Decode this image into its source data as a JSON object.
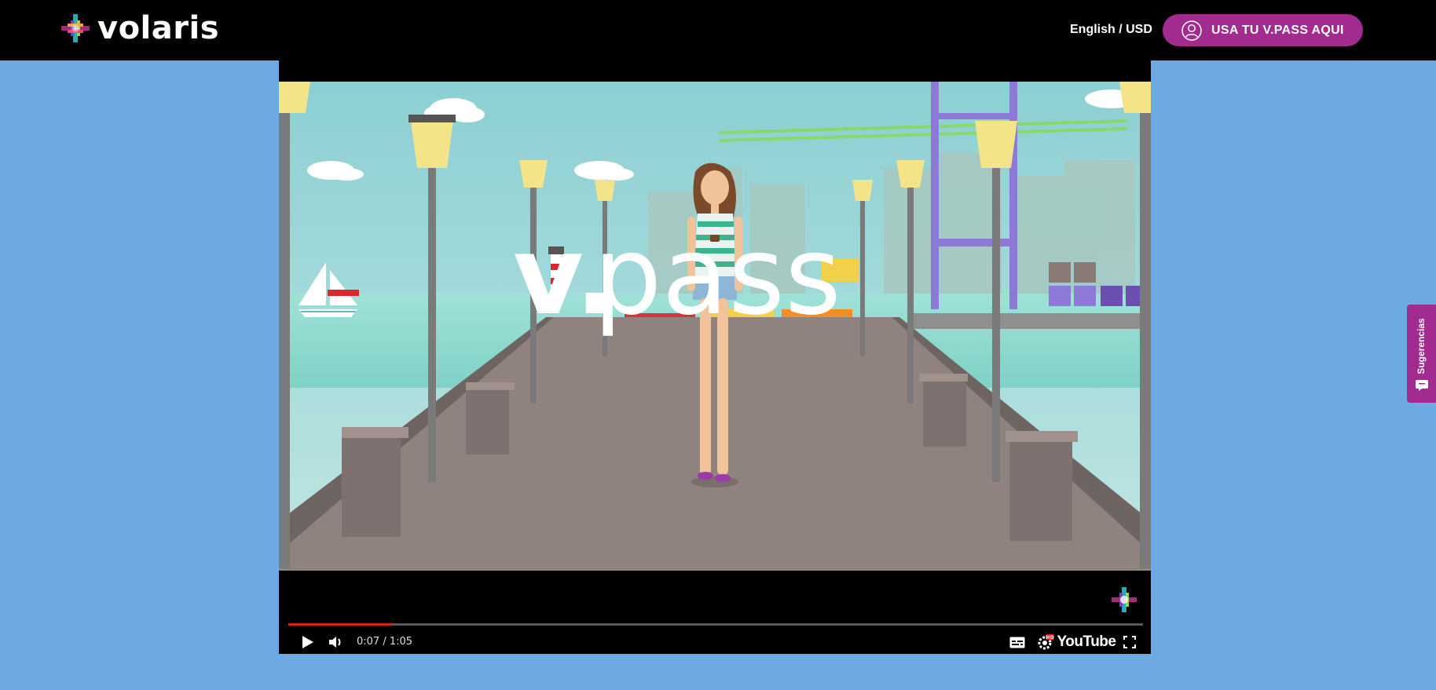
{
  "header": {
    "brand": "volaris",
    "language_currency": "English / USD",
    "vpass_button": "USA TU V.PASS AQUI"
  },
  "video": {
    "title_overlay": "v.pass",
    "time_display": "0:07 / 1:05",
    "progress_fraction": 0.12,
    "quality_badge": "HD",
    "brand_button": "YouTube"
  },
  "feedback_tab": {
    "label": "Sugerencias"
  },
  "colors": {
    "page_background": "#6daae3",
    "brand_purple": "#a12b8e",
    "progress_red": "#e01e1e"
  },
  "icons": [
    "user-icon",
    "play-icon",
    "volume-icon",
    "subtitles-icon",
    "settings-icon",
    "fullscreen-icon",
    "feedback-icon"
  ]
}
